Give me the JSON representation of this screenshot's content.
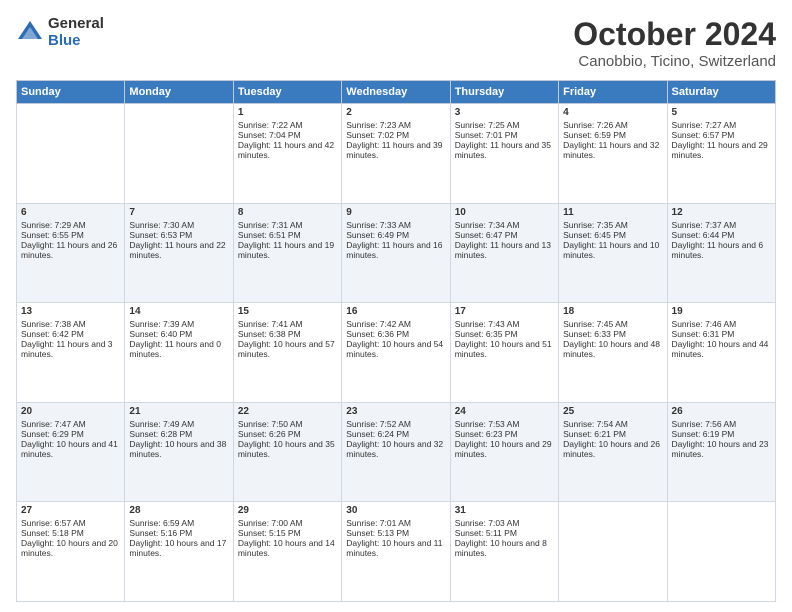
{
  "header": {
    "logo_general": "General",
    "logo_blue": "Blue",
    "month_title": "October 2024",
    "location": "Canobbio, Ticino, Switzerland"
  },
  "weekdays": [
    "Sunday",
    "Monday",
    "Tuesday",
    "Wednesday",
    "Thursday",
    "Friday",
    "Saturday"
  ],
  "rows": [
    [
      {
        "day": "",
        "sunrise": "",
        "sunset": "",
        "daylight": ""
      },
      {
        "day": "",
        "sunrise": "",
        "sunset": "",
        "daylight": ""
      },
      {
        "day": "1",
        "sunrise": "Sunrise: 7:22 AM",
        "sunset": "Sunset: 7:04 PM",
        "daylight": "Daylight: 11 hours and 42 minutes."
      },
      {
        "day": "2",
        "sunrise": "Sunrise: 7:23 AM",
        "sunset": "Sunset: 7:02 PM",
        "daylight": "Daylight: 11 hours and 39 minutes."
      },
      {
        "day": "3",
        "sunrise": "Sunrise: 7:25 AM",
        "sunset": "Sunset: 7:01 PM",
        "daylight": "Daylight: 11 hours and 35 minutes."
      },
      {
        "day": "4",
        "sunrise": "Sunrise: 7:26 AM",
        "sunset": "Sunset: 6:59 PM",
        "daylight": "Daylight: 11 hours and 32 minutes."
      },
      {
        "day": "5",
        "sunrise": "Sunrise: 7:27 AM",
        "sunset": "Sunset: 6:57 PM",
        "daylight": "Daylight: 11 hours and 29 minutes."
      }
    ],
    [
      {
        "day": "6",
        "sunrise": "Sunrise: 7:29 AM",
        "sunset": "Sunset: 6:55 PM",
        "daylight": "Daylight: 11 hours and 26 minutes."
      },
      {
        "day": "7",
        "sunrise": "Sunrise: 7:30 AM",
        "sunset": "Sunset: 6:53 PM",
        "daylight": "Daylight: 11 hours and 22 minutes."
      },
      {
        "day": "8",
        "sunrise": "Sunrise: 7:31 AM",
        "sunset": "Sunset: 6:51 PM",
        "daylight": "Daylight: 11 hours and 19 minutes."
      },
      {
        "day": "9",
        "sunrise": "Sunrise: 7:33 AM",
        "sunset": "Sunset: 6:49 PM",
        "daylight": "Daylight: 11 hours and 16 minutes."
      },
      {
        "day": "10",
        "sunrise": "Sunrise: 7:34 AM",
        "sunset": "Sunset: 6:47 PM",
        "daylight": "Daylight: 11 hours and 13 minutes."
      },
      {
        "day": "11",
        "sunrise": "Sunrise: 7:35 AM",
        "sunset": "Sunset: 6:45 PM",
        "daylight": "Daylight: 11 hours and 10 minutes."
      },
      {
        "day": "12",
        "sunrise": "Sunrise: 7:37 AM",
        "sunset": "Sunset: 6:44 PM",
        "daylight": "Daylight: 11 hours and 6 minutes."
      }
    ],
    [
      {
        "day": "13",
        "sunrise": "Sunrise: 7:38 AM",
        "sunset": "Sunset: 6:42 PM",
        "daylight": "Daylight: 11 hours and 3 minutes."
      },
      {
        "day": "14",
        "sunrise": "Sunrise: 7:39 AM",
        "sunset": "Sunset: 6:40 PM",
        "daylight": "Daylight: 11 hours and 0 minutes."
      },
      {
        "day": "15",
        "sunrise": "Sunrise: 7:41 AM",
        "sunset": "Sunset: 6:38 PM",
        "daylight": "Daylight: 10 hours and 57 minutes."
      },
      {
        "day": "16",
        "sunrise": "Sunrise: 7:42 AM",
        "sunset": "Sunset: 6:36 PM",
        "daylight": "Daylight: 10 hours and 54 minutes."
      },
      {
        "day": "17",
        "sunrise": "Sunrise: 7:43 AM",
        "sunset": "Sunset: 6:35 PM",
        "daylight": "Daylight: 10 hours and 51 minutes."
      },
      {
        "day": "18",
        "sunrise": "Sunrise: 7:45 AM",
        "sunset": "Sunset: 6:33 PM",
        "daylight": "Daylight: 10 hours and 48 minutes."
      },
      {
        "day": "19",
        "sunrise": "Sunrise: 7:46 AM",
        "sunset": "Sunset: 6:31 PM",
        "daylight": "Daylight: 10 hours and 44 minutes."
      }
    ],
    [
      {
        "day": "20",
        "sunrise": "Sunrise: 7:47 AM",
        "sunset": "Sunset: 6:29 PM",
        "daylight": "Daylight: 10 hours and 41 minutes."
      },
      {
        "day": "21",
        "sunrise": "Sunrise: 7:49 AM",
        "sunset": "Sunset: 6:28 PM",
        "daylight": "Daylight: 10 hours and 38 minutes."
      },
      {
        "day": "22",
        "sunrise": "Sunrise: 7:50 AM",
        "sunset": "Sunset: 6:26 PM",
        "daylight": "Daylight: 10 hours and 35 minutes."
      },
      {
        "day": "23",
        "sunrise": "Sunrise: 7:52 AM",
        "sunset": "Sunset: 6:24 PM",
        "daylight": "Daylight: 10 hours and 32 minutes."
      },
      {
        "day": "24",
        "sunrise": "Sunrise: 7:53 AM",
        "sunset": "Sunset: 6:23 PM",
        "daylight": "Daylight: 10 hours and 29 minutes."
      },
      {
        "day": "25",
        "sunrise": "Sunrise: 7:54 AM",
        "sunset": "Sunset: 6:21 PM",
        "daylight": "Daylight: 10 hours and 26 minutes."
      },
      {
        "day": "26",
        "sunrise": "Sunrise: 7:56 AM",
        "sunset": "Sunset: 6:19 PM",
        "daylight": "Daylight: 10 hours and 23 minutes."
      }
    ],
    [
      {
        "day": "27",
        "sunrise": "Sunrise: 6:57 AM",
        "sunset": "Sunset: 5:18 PM",
        "daylight": "Daylight: 10 hours and 20 minutes."
      },
      {
        "day": "28",
        "sunrise": "Sunrise: 6:59 AM",
        "sunset": "Sunset: 5:16 PM",
        "daylight": "Daylight: 10 hours and 17 minutes."
      },
      {
        "day": "29",
        "sunrise": "Sunrise: 7:00 AM",
        "sunset": "Sunset: 5:15 PM",
        "daylight": "Daylight: 10 hours and 14 minutes."
      },
      {
        "day": "30",
        "sunrise": "Sunrise: 7:01 AM",
        "sunset": "Sunset: 5:13 PM",
        "daylight": "Daylight: 10 hours and 11 minutes."
      },
      {
        "day": "31",
        "sunrise": "Sunrise: 7:03 AM",
        "sunset": "Sunset: 5:11 PM",
        "daylight": "Daylight: 10 hours and 8 minutes."
      },
      {
        "day": "",
        "sunrise": "",
        "sunset": "",
        "daylight": ""
      },
      {
        "day": "",
        "sunrise": "",
        "sunset": "",
        "daylight": ""
      }
    ]
  ]
}
